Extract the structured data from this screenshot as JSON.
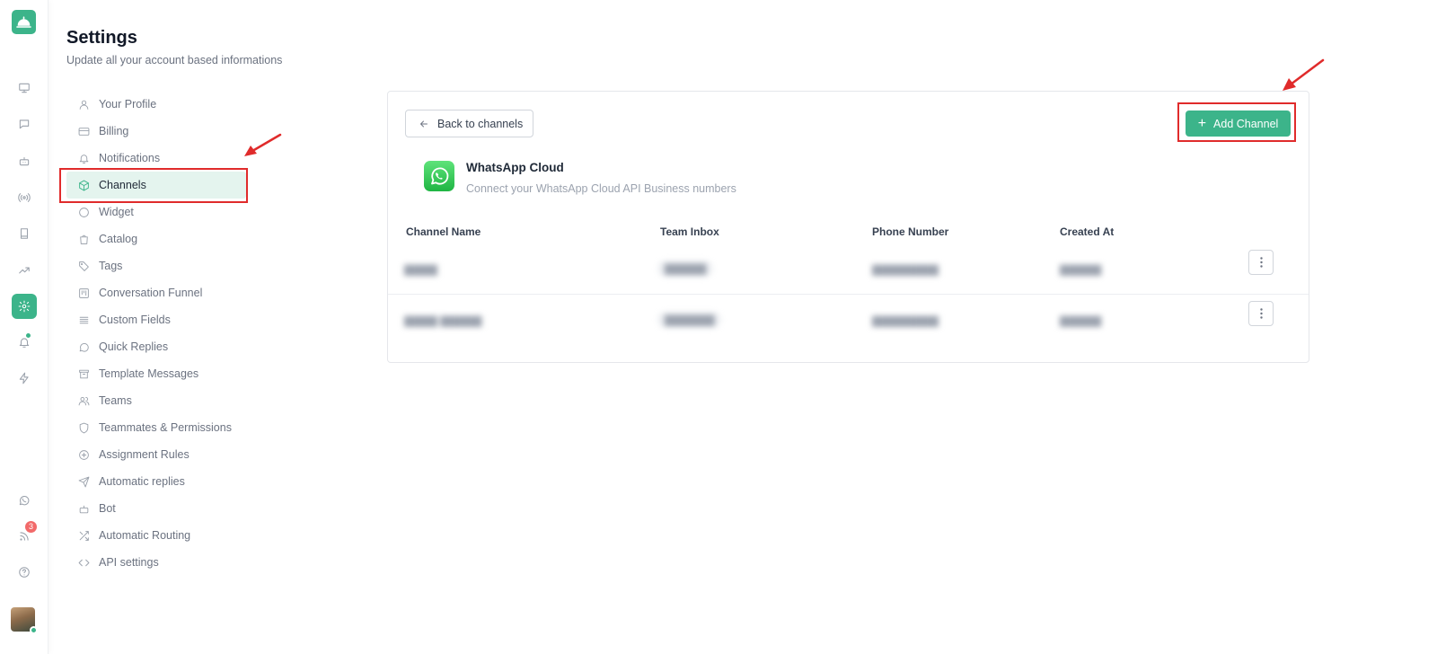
{
  "header": {
    "title": "Settings",
    "subtitle": "Update all your account based informations"
  },
  "rail": {
    "items": [
      {
        "icon": "monitor-icon"
      },
      {
        "icon": "chat-icon"
      },
      {
        "icon": "bot-icon"
      },
      {
        "icon": "broadcast-icon"
      },
      {
        "icon": "book-icon"
      },
      {
        "icon": "trending-icon"
      },
      {
        "icon": "gear-icon",
        "active": true
      },
      {
        "icon": "bell-icon"
      },
      {
        "icon": "bolt-icon"
      },
      {
        "icon": "whatsapp-icon"
      },
      {
        "icon": "rss-icon",
        "badge": "3"
      },
      {
        "icon": "help-icon"
      }
    ],
    "rss_badge": "3"
  },
  "nav": {
    "items": [
      {
        "label": "Your Profile",
        "icon": "user-icon"
      },
      {
        "label": "Billing",
        "icon": "credit-card-icon"
      },
      {
        "label": "Notifications",
        "icon": "bell-icon"
      },
      {
        "label": "Channels",
        "icon": "cube-icon",
        "active": true
      },
      {
        "label": "Widget",
        "icon": "circle-icon"
      },
      {
        "label": "Catalog",
        "icon": "shopping-bag-icon"
      },
      {
        "label": "Tags",
        "icon": "tag-icon"
      },
      {
        "label": "Conversation Funnel",
        "icon": "kanban-icon"
      },
      {
        "label": "Custom Fields",
        "icon": "list-icon"
      },
      {
        "label": "Quick Replies",
        "icon": "message-circle-icon"
      },
      {
        "label": "Template Messages",
        "icon": "archive-icon"
      },
      {
        "label": "Teams",
        "icon": "users-icon"
      },
      {
        "label": "Teammates & Permissions",
        "icon": "shield-icon"
      },
      {
        "label": "Assignment Rules",
        "icon": "plus-circle-icon"
      },
      {
        "label": "Automatic replies",
        "icon": "send-icon"
      },
      {
        "label": "Bot",
        "icon": "bot-icon"
      },
      {
        "label": "Automatic Routing",
        "icon": "shuffle-icon"
      },
      {
        "label": "API settings",
        "icon": "code-icon"
      }
    ]
  },
  "card": {
    "back_label": "Back to channels",
    "add_label": "Add Channel",
    "channel_title": "WhatsApp Cloud",
    "channel_desc": "Connect your WhatsApp Cloud API Business numbers",
    "columns": [
      "Channel Name",
      "Team Inbox",
      "Phone Number",
      "Created At"
    ]
  },
  "colors": {
    "accent": "#3cb48a",
    "highlight": "#e02b2b",
    "badge": "#f26a6a"
  }
}
